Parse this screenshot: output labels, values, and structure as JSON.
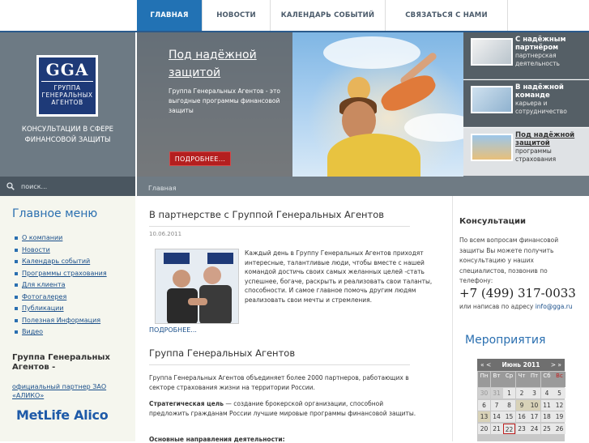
{
  "nav": {
    "items": [
      "ГЛАВНАЯ",
      "НОВОСТИ",
      "КАЛЕНДАРЬ СОБЫТИЙ",
      "СВЯЗАТЬСЯ С НАМИ"
    ],
    "active_index": 0
  },
  "logo": {
    "abbr": "GGA",
    "line1": "ГРУППА",
    "line2": "ГЕНЕРАЛЬНЫХ",
    "line3": "АГЕНТОВ"
  },
  "tagline": "КОНСУЛЬТАЦИИ В СФЕРЕ ФИНАНСОВОЙ ЗАЩИТЫ",
  "search": {
    "placeholder": "поиск..."
  },
  "hero": {
    "title": "Под надёжной защитой",
    "text": "Группа Генеральных Агентов - это выгодные программы финансовой защиты",
    "button": "ПОДРОБНЕЕ..."
  },
  "panels": [
    {
      "title": "С надёжным партнёром",
      "subtitle": "партнерская деятельность",
      "selected": false
    },
    {
      "title": "В надёжной команде",
      "subtitle": "карьера и сотрудничество",
      "selected": false
    },
    {
      "title": "Под надёжной защитой",
      "subtitle": "программы страхования",
      "selected": true
    }
  ],
  "breadcrumb": "Главная",
  "main_menu": {
    "title": "Главное меню",
    "items": [
      "О компании",
      "Новости",
      "Календарь событий",
      "Программы страхования",
      "Для клиента",
      "Фотогалерея",
      "Публикации",
      "Полезная Информация",
      "Видео"
    ]
  },
  "group_block": {
    "title": "Группа Генеральных Агентов -",
    "subtitle": "официальный партнер ЗАО «АЛИКО»",
    "partner_logo": "MetLife Alico"
  },
  "article1": {
    "title": "В партнерстве с Группой Генеральных Агентов",
    "date": "10.06.2011",
    "text": "Каждый день в Группу Генеральных Агентов приходят интересные, талантливые люди, чтобы вместе с нашей командой достичь своих самых желанных целей -стать успешнее, богаче, раскрыть и реализовать свои таланты, способности. И самое главное помочь другим людям реализовать свои мечты и стремления.",
    "more": "ПОДРОБНЕЕ..."
  },
  "article2": {
    "title": "Группа Генеральных Агентов",
    "p1": "Группа Генеральных Агентов объединяет более 2000 партнеров, работающих в секторе страхования жизни на территории России.",
    "p2_label": "Стратегическая цель",
    "p2_text": " — создание брокерской организации, способной предложить гражданам России лучшие мировые программы финансовой защиты.",
    "p3": "Основные направления деятельности:"
  },
  "consult": {
    "title": "Консультации",
    "text": "По всем вопросам финансовой защиты Вы можете получить консультацию у наших специалистов, позвонив по телефону:",
    "phone": "+7 (499) 317-0033",
    "email_prefix": "или написав по адресу ",
    "email": "info@gga.ru"
  },
  "events": {
    "title": "Мероприятия",
    "prev": "« <",
    "next": "> »",
    "month": "Июнь 2011",
    "weekdays": [
      "Пн",
      "Вт",
      "Ср",
      "Чт",
      "Пт",
      "Сб",
      "Вс"
    ],
    "weeks": [
      [
        "30",
        "31",
        "1",
        "2",
        "3",
        "4",
        "5"
      ],
      [
        "6",
        "7",
        "8",
        "9",
        "10",
        "11",
        "12"
      ],
      [
        "13",
        "14",
        "15",
        "16",
        "17",
        "18",
        "19"
      ],
      [
        "20",
        "21",
        "22",
        "23",
        "24",
        "25",
        "26"
      ]
    ]
  }
}
